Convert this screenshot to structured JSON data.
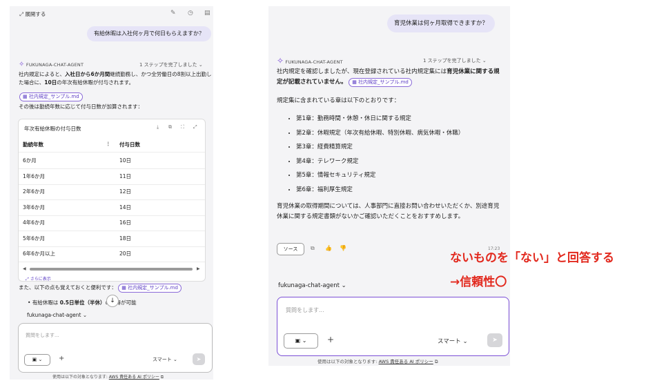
{
  "left": {
    "expand_label": "展開する",
    "user_question": "有給休暇は入社何ヶ月で何日もらえますか？",
    "agent_name": "FUKUNAGA-CHAT-AGENT",
    "steps": "1 ステップを完了しました",
    "answer_p1": "社内規定によると、",
    "answer_b1": "入社日から6か月間",
    "answer_p2": "継続勤務し、かつ全労働日の8割以上出勤した場合に、",
    "answer_b2": "10日",
    "answer_p3": "の年次有給休暇が付与されます。",
    "source_chip": "社内規定_サンプル.md",
    "followup": "その後は勤続年数に応じて付与日数が加算されます：",
    "table": {
      "title": "年次有給休暇の付与日数",
      "headers": [
        "勤続年数",
        "付与日数"
      ],
      "rows": [
        [
          "6か月",
          "10日"
        ],
        [
          "1年6か月",
          "11日"
        ],
        [
          "2年6か月",
          "12日"
        ],
        [
          "3年6か月",
          "14日"
        ],
        [
          "4年6か月",
          "16日"
        ],
        [
          "5年6か月",
          "18日"
        ],
        [
          "6年6か月以上",
          "20日"
        ]
      ],
      "more": "さらに表示"
    },
    "also_text": "また、以下の点も覚えておくと便利です：",
    "also_chip": "社内規定_サンプル.md",
    "bullet_p1": "有給休暇は ",
    "bullet_b1": "0.5日単位（半休）",
    "bullet_p2": "の取得が可能",
    "agent_select": "fukunaga-chat-agent",
    "input_placeholder": "質問をします...",
    "mode": "スマート",
    "footer_text": "使用は以下の対象となります: ",
    "footer_link": "AWS 責任ある AI ポリシー"
  },
  "right": {
    "user_question": "育児休業は何ヶ月取得できますか？",
    "agent_name": "FUKUNAGA-CHAT-AGENT",
    "steps": "1 ステップを完了しました",
    "answer_p1": "社内規定を確認しましたが、現在登録されている社内規定集には",
    "answer_b1": "育児休業に関する規定が記載されていません。",
    "source_chip": "社内規定_サンプル.md",
    "intro": "規定集に含まれている章は以下のとおりです：",
    "chapters": [
      "第1章：勤務時間・休憩・休日に関する規定",
      "第2章：休暇規定（年次有給休暇、特別休暇、病気休暇・休職）",
      "第3章：経費精算規定",
      "第4章：テレワーク規定",
      "第5章：情報セキュリティ規定",
      "第6章：福利厚生規定"
    ],
    "closing": "育児休業の取得期間については、人事部門に直接お問い合わせいただくか、別途育児休業に関する規定書類がないかご確認いただくことをおすすめします。",
    "source_button": "ソース",
    "time": "17:23",
    "agent_select": "fukunaga-chat-agent",
    "input_placeholder": "質問をします...",
    "mode": "スマート",
    "footer_text": "使用は以下の対象となります: ",
    "footer_link": "AWS 責任ある AI ポリシー"
  },
  "annotation": {
    "line1": "ないものを「ない」と回答する",
    "line2": "→信頼性〇"
  },
  "colors": {
    "accent": "#7b4fd6",
    "note": "#e2291e",
    "bubble": "#e6e4f7"
  }
}
